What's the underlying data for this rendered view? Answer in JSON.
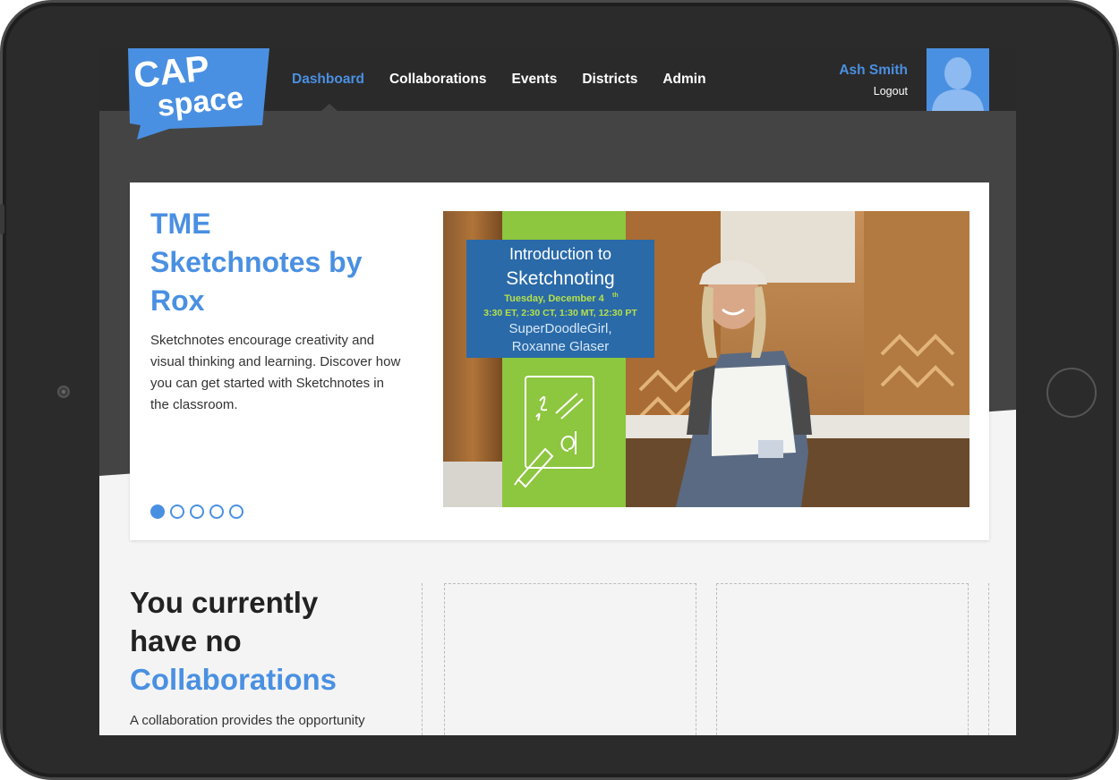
{
  "app": {
    "logo_line1": "CAP",
    "logo_line2": "space"
  },
  "nav": {
    "items": [
      {
        "label": "Dashboard",
        "active": true
      },
      {
        "label": "Collaborations",
        "active": false
      },
      {
        "label": "Events",
        "active": false
      },
      {
        "label": "Districts",
        "active": false
      },
      {
        "label": "Admin",
        "active": false
      }
    ]
  },
  "user": {
    "name": "Ash Smith",
    "logout_label": "Logout"
  },
  "carousel": {
    "title_lines": [
      "TME",
      "Sketchnotes by",
      "Rox"
    ],
    "description": "Sketchnotes encourage creativity and visual thinking and learning. Discover how you can get started with Sketchnotes in the classroom.",
    "slide_count": 5,
    "active_slide": 1,
    "image": {
      "heading1": "Introduction to",
      "heading2": "Sketchnoting",
      "date_prefix": "Tuesday, December 4",
      "date_suffix": "th",
      "times": "3:30 ET, 2:30 CT, 1:30 MT, 12:30 PT",
      "presenter1": "SuperDoodleGirl,",
      "presenter2": "Roxanne Glaser"
    }
  },
  "collaborations": {
    "title_line1": "You currently",
    "title_line2": "have no",
    "title_line3": "Collaborations",
    "description": "A collaboration provides the opportunity"
  },
  "colors": {
    "accent": "#4a90e2",
    "header_bg": "#2a2a2a",
    "hero_bg": "#444444",
    "content_bg": "#f4f4f4",
    "card_green": "#8dc63f",
    "card_blue": "#2a6aa8"
  }
}
